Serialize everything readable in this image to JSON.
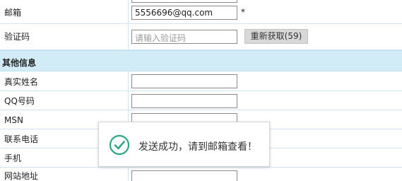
{
  "form": {
    "email": {
      "label": "邮箱",
      "value": "5556696@qq.com",
      "required_mark": "*"
    },
    "captcha": {
      "label": "验证码",
      "placeholder": "请输入验证码",
      "resend_button": "重新获取(59)"
    },
    "section_title": "其他信息",
    "fields": [
      {
        "label": "真实姓名",
        "value": ""
      },
      {
        "label": "QQ号码",
        "value": ""
      },
      {
        "label": "MSN",
        "value": ""
      },
      {
        "label": "联系电话",
        "value": ""
      },
      {
        "label": "手机",
        "value": ""
      },
      {
        "label": "网站地址",
        "value": ""
      }
    ]
  },
  "toast": {
    "message": "发送成功，请到邮箱查看！",
    "icon": "check-circle-icon",
    "accent_color": "#2fa882"
  },
  "colors": {
    "grid_line": "#cfe6f2",
    "section_bg": "#d2ecf7",
    "button_bg": "#d8d8d8"
  }
}
